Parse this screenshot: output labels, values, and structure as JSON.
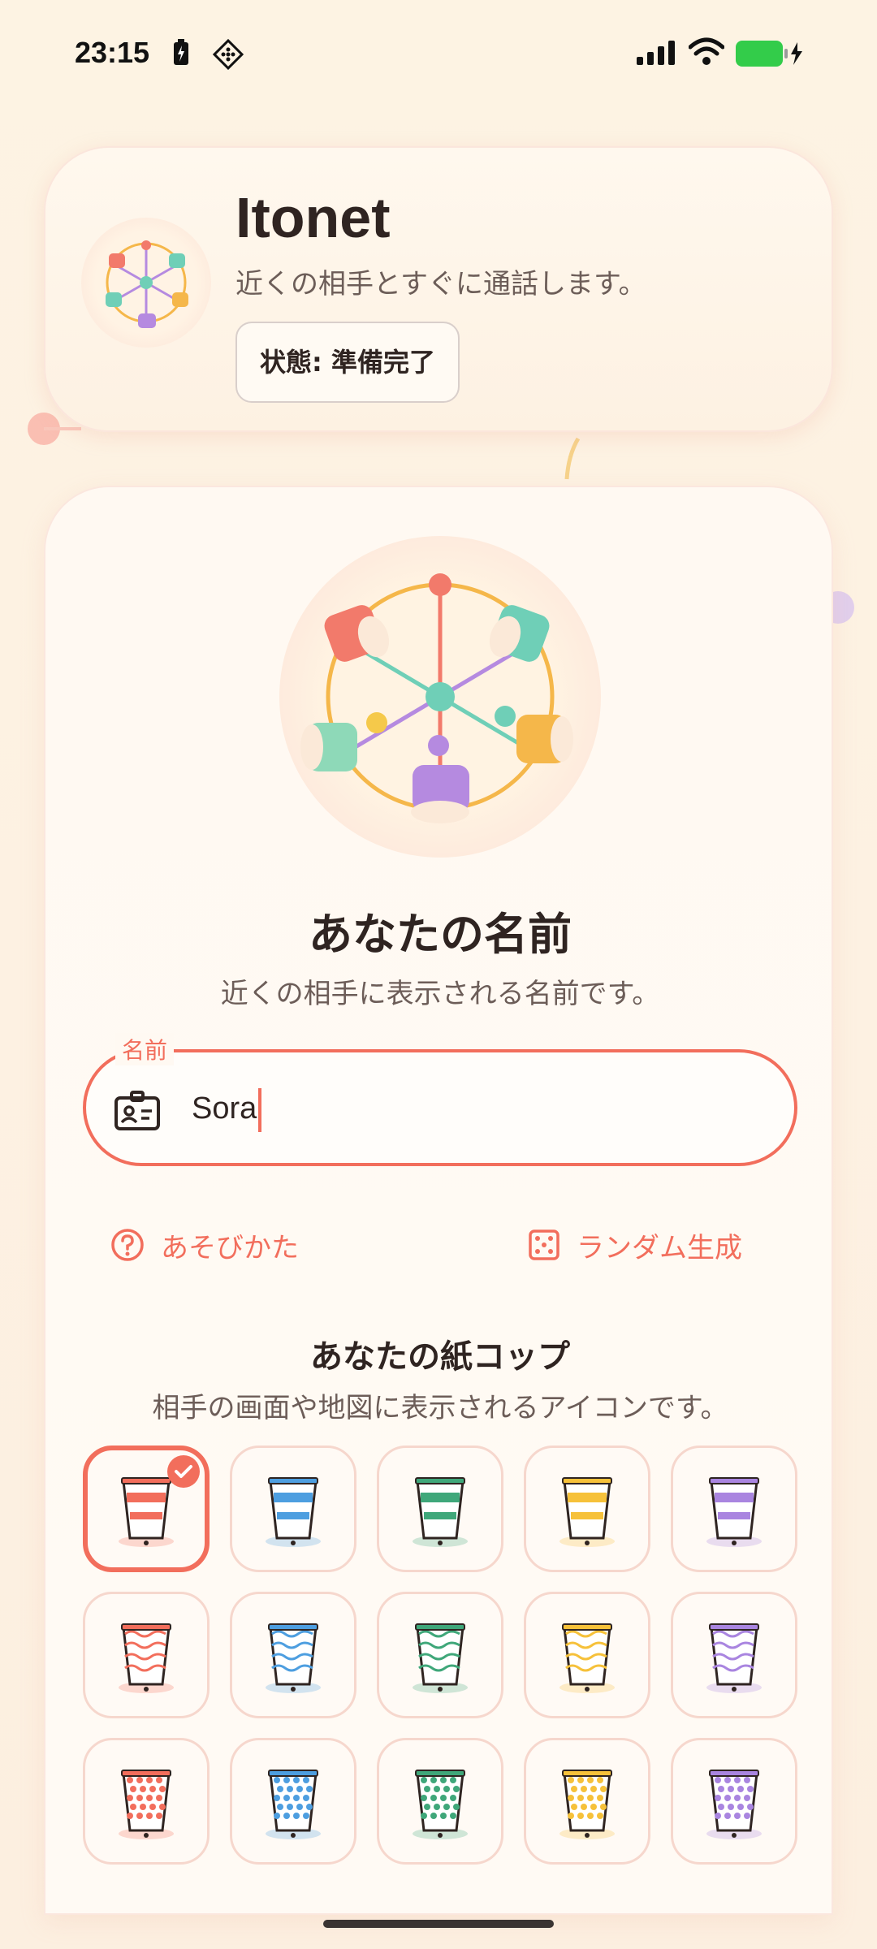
{
  "status_bar": {
    "time": "23:15"
  },
  "header": {
    "app_title": "Itonet",
    "subtitle": "近くの相手とすぐに通話します。",
    "status_chip": "状態: 準備完了"
  },
  "name_section": {
    "title": "あなたの名前",
    "subtitle": "近くの相手に表示される名前です。",
    "field_label": "名前",
    "field_value": "Sora"
  },
  "actions": {
    "howto_label": "あそびかた",
    "random_label": "ランダム生成"
  },
  "cup_section": {
    "title": "あなたの紙コップ",
    "subtitle": "相手の画面や地図に表示されるアイコンです。",
    "selected_index": 0,
    "cups": [
      {
        "pattern": "stripe",
        "color": "#f26e5c"
      },
      {
        "pattern": "stripe",
        "color": "#4d9ee0"
      },
      {
        "pattern": "stripe",
        "color": "#3fa77a"
      },
      {
        "pattern": "stripe",
        "color": "#f6c13a"
      },
      {
        "pattern": "stripe",
        "color": "#a985e0"
      },
      {
        "pattern": "wave",
        "color": "#f26e5c"
      },
      {
        "pattern": "wave",
        "color": "#4d9ee0"
      },
      {
        "pattern": "wave",
        "color": "#3fa77a"
      },
      {
        "pattern": "wave",
        "color": "#f6c13a"
      },
      {
        "pattern": "wave",
        "color": "#a985e0"
      },
      {
        "pattern": "dots",
        "color": "#f26e5c"
      },
      {
        "pattern": "dots",
        "color": "#4d9ee0"
      },
      {
        "pattern": "dots",
        "color": "#3fa77a"
      },
      {
        "pattern": "dots",
        "color": "#f6c13a"
      },
      {
        "pattern": "dots",
        "color": "#a985e0"
      }
    ]
  },
  "colors": {
    "accent": "#f26e5c",
    "background": "#fdf3e3"
  }
}
